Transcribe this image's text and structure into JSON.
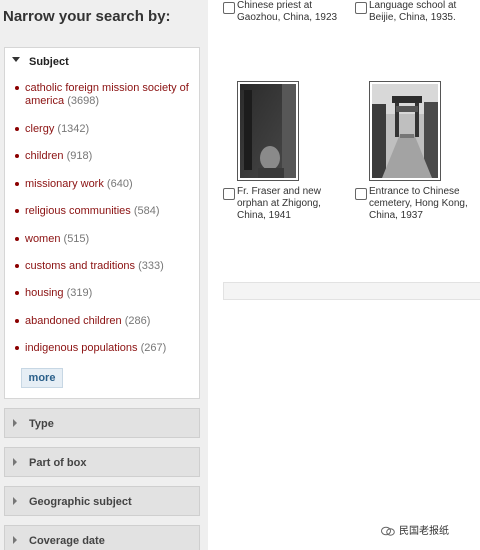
{
  "sidebar": {
    "title": "Narrow your search by:",
    "open_facet": {
      "label": "Subject",
      "items": [
        {
          "label": "catholic foreign mission society of america",
          "count": "(3698)"
        },
        {
          "label": "clergy",
          "count": "(1342)"
        },
        {
          "label": "children",
          "count": "(918)"
        },
        {
          "label": "missionary work",
          "count": "(640)"
        },
        {
          "label": "religious communities",
          "count": "(584)"
        },
        {
          "label": "women",
          "count": "(515)"
        },
        {
          "label": "customs and traditions",
          "count": "(333)"
        },
        {
          "label": "housing",
          "count": "(319)"
        },
        {
          "label": "abandoned children",
          "count": "(286)"
        },
        {
          "label": "indigenous populations",
          "count": "(267)"
        }
      ],
      "more_label": "more"
    },
    "closed_facets": [
      {
        "label": "Type"
      },
      {
        "label": "Part of box"
      },
      {
        "label": "Geographic subject"
      },
      {
        "label": "Coverage date"
      }
    ]
  },
  "results": [
    {
      "caption": "Chinese priest at Gaozhou, China, 1923"
    },
    {
      "caption": "Language school at Beijie, China, 1935."
    },
    {
      "caption": "Fr. Fraser and new orphan at Zhigong, China, 1941"
    },
    {
      "caption": "Entrance to Chinese cemetery, Hong Kong, China, 1937"
    }
  ],
  "watermark": {
    "text": "民国老报纸"
  },
  "colors": {
    "link": "#8b1111",
    "count": "#777777",
    "sidebar_bg": "#efefef",
    "more_button_bg": "#e6eef5"
  }
}
